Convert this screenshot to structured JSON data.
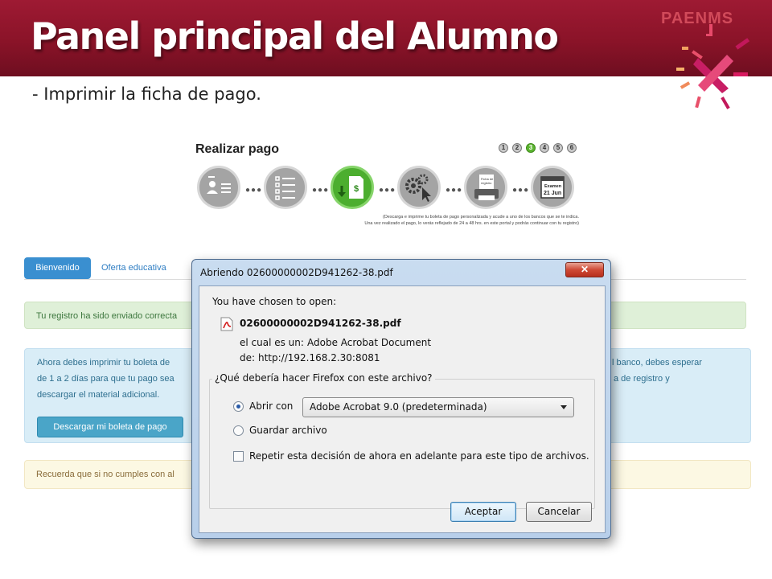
{
  "slide": {
    "title": "Panel principal del Alumno",
    "brand": "PAENMS",
    "subtitle": "- Imprimir la ficha de pago."
  },
  "steps": {
    "title": "Realizar pago",
    "numbers": [
      "1",
      "2",
      "3",
      "4",
      "5",
      "6"
    ],
    "active_step": 3,
    "icons": [
      "user-list-icon",
      "checklist-icon",
      "money-download-icon",
      "gears-cursor-icon",
      "registration-form-printer-icon",
      "calendar-exam-icon"
    ],
    "calendar_label": "Examen",
    "calendar_date": "21 Jun",
    "form_label": "Ficha de registro",
    "note_line1": "(Descarga e imprime tu boleta de pago personalizada y acude a uno de los bancos que se te indica.",
    "note_line2": "Una vez realizado el pago, lo verás reflejado de 24 a 48 hrs. en este portal y podrás continuar con tu registro)"
  },
  "page": {
    "tab_active": "Bienvenido",
    "tab_other": "Oferta educativa",
    "success_text": "Tu registro ha sido enviado correcta",
    "info_line1_left": "Ahora debes imprimir tu boleta de",
    "info_line1_right": "l banco, debes esperar",
    "info_line2_left": "de 1 a 2 días para que tu pago sea",
    "info_line2_right": "a de registro y",
    "info_line3": "descargar el material adicional.",
    "download_button": "Descargar mi boleta de pago",
    "warning_text": "Recuerda que si no cumples con al"
  },
  "dialog": {
    "title": "Abriendo 02600000002D941262-38.pdf",
    "close_label": "✕",
    "chosen_label": "You have chosen to open:",
    "file_name": "02600000002D941262-38.pdf",
    "type_label": "el cual es un:",
    "type_value": "Adobe Acrobat Document",
    "from_label": "de:",
    "from_value": "http://192.168.2.30:8081",
    "question": "¿Qué debería hacer Firefox con este archivo?",
    "open_with_label": "Abrir con",
    "open_with_value": "Adobe Acrobat 9.0 (predeterminada)",
    "save_label": "Guardar archivo",
    "repeat_label": "Repetir esta decisión de ahora en adelante para este tipo de archivos.",
    "accept_label": "Aceptar",
    "cancel_label": "Cancelar"
  },
  "colors": {
    "header": "#8a1328",
    "active_step": "#4cae2f",
    "primary_tab": "#3a8fd0"
  }
}
